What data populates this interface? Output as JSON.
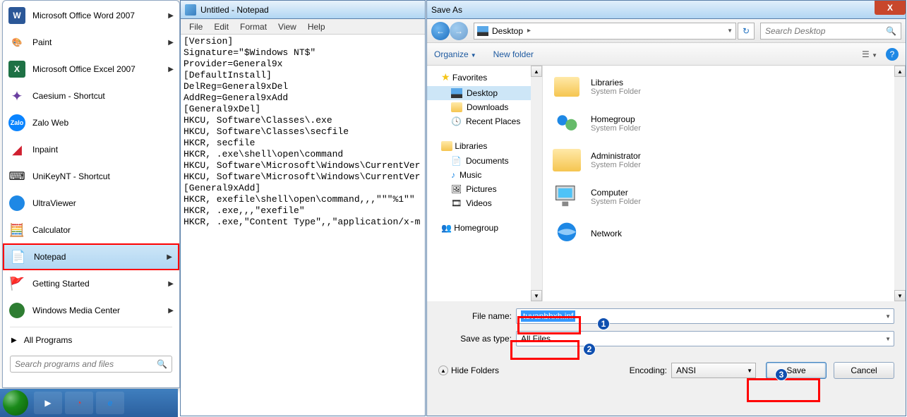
{
  "start_menu": {
    "items": [
      {
        "label": "Microsoft Office Word 2007",
        "arrow": true
      },
      {
        "label": "Paint",
        "arrow": true
      },
      {
        "label": "Microsoft Office Excel 2007",
        "arrow": true
      },
      {
        "label": "Caesium - Shortcut",
        "arrow": false
      },
      {
        "label": "Zalo Web",
        "arrow": false
      },
      {
        "label": "Inpaint",
        "arrow": false
      },
      {
        "label": "UniKeyNT - Shortcut",
        "arrow": false
      },
      {
        "label": "UltraViewer",
        "arrow": false
      },
      {
        "label": "Calculator",
        "arrow": false
      },
      {
        "label": "Notepad",
        "arrow": true,
        "selected": true
      },
      {
        "label": "Getting Started",
        "arrow": true
      },
      {
        "label": "Windows Media Center",
        "arrow": true
      }
    ],
    "all_programs": "All Programs",
    "search_placeholder": "Search programs and files"
  },
  "notepad": {
    "title": "Untitled - Notepad",
    "menu": [
      "File",
      "Edit",
      "Format",
      "View",
      "Help"
    ],
    "content": "[Version]\nSignature=\"$Windows NT$\"\nProvider=General9x\n[DefaultInstall]\nDelReg=General9xDel\nAddReg=General9xAdd\n[General9xDel]\nHKCU, Software\\Classes\\.exe\nHKCU, Software\\Classes\\secfile\nHKCR, secfile\nHKCR, .exe\\shell\\open\\command\nHKCU, Software\\Microsoft\\Windows\\CurrentVer\nHKCU, Software\\Microsoft\\Windows\\CurrentVer\n[General9xAdd]\nHKCR, exefile\\shell\\open\\command,,,\"\"\"%1\"\"\nHKCR, .exe,,,\"exefile\"\nHKCR, .exe,\"Content Type\",,\"application/x-m"
  },
  "saveas": {
    "title": "Save As",
    "close": "X",
    "breadcrumb": "Desktop",
    "breadcrumb_arrow": "▸",
    "search_placeholder": "Search Desktop",
    "organize": "Organize",
    "new_folder": "New folder",
    "tree": {
      "favorites": "Favorites",
      "fav_items": [
        "Desktop",
        "Downloads",
        "Recent Places"
      ],
      "libraries": "Libraries",
      "lib_items": [
        "Documents",
        "Music",
        "Pictures",
        "Videos"
      ],
      "homegroup": "Homegroup"
    },
    "folders": [
      {
        "name": "Libraries",
        "sub": "System Folder"
      },
      {
        "name": "Homegroup",
        "sub": "System Folder"
      },
      {
        "name": "Administrator",
        "sub": "System Folder"
      },
      {
        "name": "Computer",
        "sub": "System Folder"
      },
      {
        "name": "Network",
        "sub": ""
      }
    ],
    "filename_label": "File name:",
    "filename_value": "tuvanbhxh.inf",
    "saveastype_label": "Save as type:",
    "saveastype_value": "All Files",
    "hide_folders": "Hide Folders",
    "encoding_label": "Encoding:",
    "encoding_value": "ANSI",
    "save_btn": "Save",
    "cancel_btn": "Cancel"
  },
  "annotations": {
    "n1": "1",
    "n2": "2",
    "n3": "3"
  }
}
